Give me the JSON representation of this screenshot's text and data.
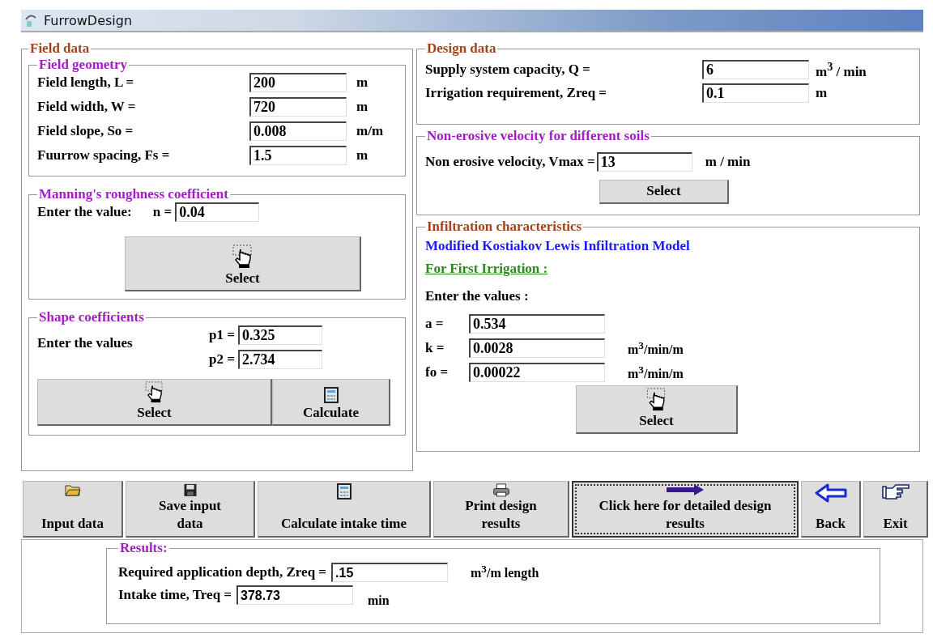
{
  "window": {
    "title": "FurrowDesign"
  },
  "field_data": {
    "title": "Field data",
    "field_geometry": {
      "title": "Field geometry",
      "rows": [
        {
          "label": "Field length, L =",
          "value": "200",
          "unit": "m"
        },
        {
          "label": "Field width, W =",
          "value": "720",
          "unit": "m"
        },
        {
          "label": "Field slope, So =",
          "value": "0.008",
          "unit": "m/m"
        },
        {
          "label": "Fuurrow spacing, Fs =",
          "value": "1.5",
          "unit": "m"
        }
      ]
    },
    "manning": {
      "title": "Manning's roughness coefficient",
      "label": "Enter the value:",
      "symbol": "n =",
      "value": "0.04",
      "button": {
        "label": "Select",
        "kind": "hand"
      }
    },
    "shape": {
      "title": "Shape coefficients",
      "label": "Enter the values",
      "rows": [
        {
          "label": "p1 =",
          "value": "0.325"
        },
        {
          "label": "p2 =",
          "value": "2.734"
        }
      ],
      "buttons": [
        {
          "label": "Select",
          "kind": "hand"
        },
        {
          "label": "Calculate",
          "kind": "calculator"
        }
      ]
    }
  },
  "design_data": {
    "title": "Design data",
    "rows": [
      {
        "label": "Supply system capacity, Q =",
        "value": "6",
        "unit": "m$^{3}$ / min"
      },
      {
        "label": "Irrigation requirement, Zreq =",
        "value": "0.1",
        "unit": "m"
      }
    ]
  },
  "non_erosive": {
    "title": "Non-erosive velocity for different soils",
    "label": "Non erosive velocity, Vmax =",
    "value": "13",
    "unit": "m / min",
    "button": "Select"
  },
  "infiltration": {
    "title": "Infiltration characteristics",
    "model": "Modified Kostiakov Lewis Infiltration Model",
    "subtitle": "For First Irrigation :",
    "prompt": "Enter the values :",
    "rows": [
      {
        "label": "a =",
        "value": "0.534"
      },
      {
        "label": "k =",
        "value": "0.0028",
        "unit": "m$^{3}$/min/m"
      },
      {
        "label": "fo =",
        "value": "0.00022",
        "unit": "m$^{3}$/min/m"
      }
    ],
    "button": {
      "label": "Select",
      "kind": "hand"
    }
  },
  "toolbar": [
    {
      "label": "Input data",
      "kind": "folder",
      "focused": false
    },
    {
      "label": "Save input data",
      "kind": "floppy",
      "focused": false
    },
    {
      "label": "Calculate intake time",
      "kind": "calculator",
      "focused": false
    },
    {
      "label": "Print design results",
      "kind": "printer",
      "focused": false
    },
    {
      "label": "Click here for detailed design results",
      "kind": "arrow",
      "focused": true
    },
    {
      "label": "Back",
      "kind": "back",
      "focused": false
    },
    {
      "label": "Exit",
      "kind": "pointer",
      "focused": false
    }
  ],
  "results": {
    "title": "Results:",
    "rows": [
      {
        "label": "Required application depth, Zreq =",
        "value": ".15",
        "unit": "m$^{3}$/m length"
      },
      {
        "label": "Intake time, Treq =",
        "value": "378.73",
        "unit": "min"
      }
    ]
  }
}
